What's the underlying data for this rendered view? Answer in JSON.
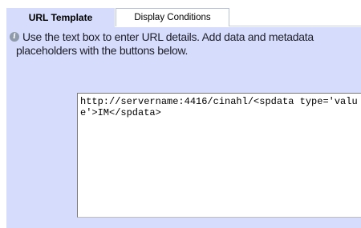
{
  "tabs": {
    "active_label": "URL Template",
    "inactive_label": "Display Conditions"
  },
  "help": {
    "icon": "info-icon",
    "text": "Use the text box to enter URL details. Add data and metadata placeholders with the buttons below."
  },
  "url_template": {
    "value": "http://servername:4416/cinahl/<spdata type='value'>IM</spdata>"
  },
  "colors": {
    "panel_background": "#d6dcfc",
    "tab_border": "#b8bfd8"
  }
}
